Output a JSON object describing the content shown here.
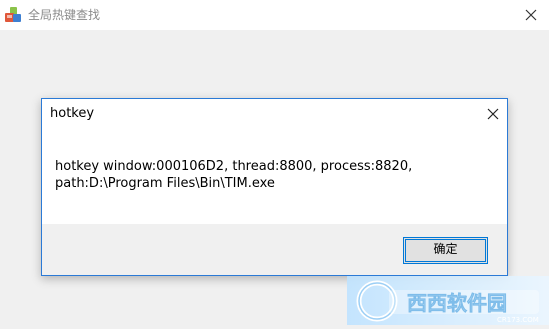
{
  "window": {
    "title": "全局热键查找",
    "icon": "app-icon",
    "close_icon": "close-icon"
  },
  "dialog": {
    "title": "hotkey",
    "message": "hotkey window:000106D2, thread:8800, process:8820, path:D:\\Program Files\\Bin\\TIM.exe",
    "ok_label": "确定",
    "close_icon": "close-icon",
    "accent_color": "#2b7ad6"
  },
  "watermark": {
    "text": "西西软件园",
    "subtext": "CR173.COM"
  }
}
